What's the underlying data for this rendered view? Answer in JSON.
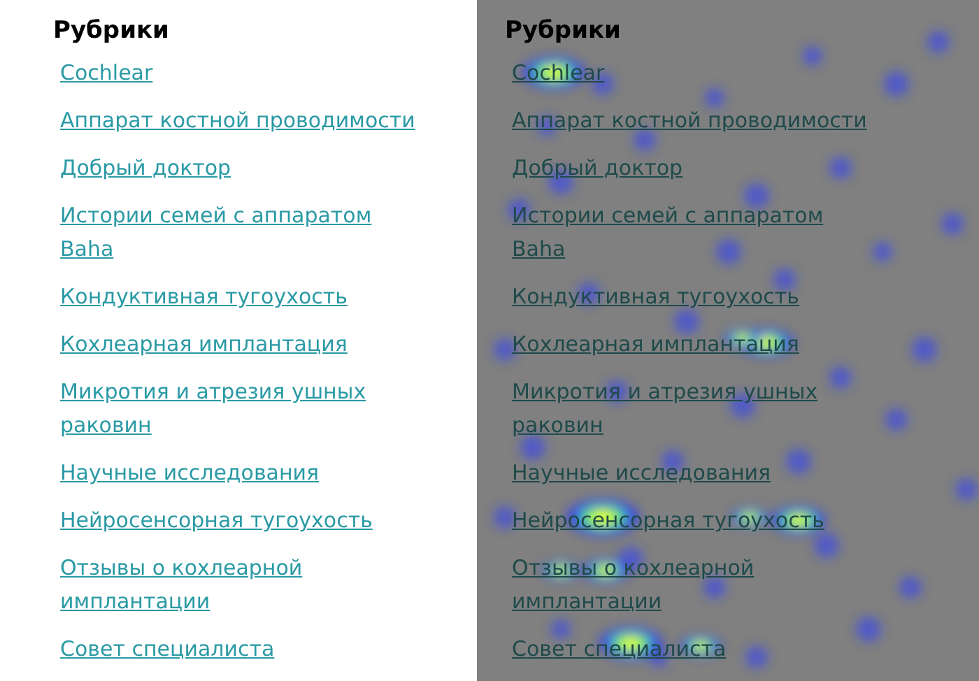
{
  "panels": [
    {
      "kind": "plain",
      "title": "Рубрики",
      "links": [
        "Cochlear",
        "Аппарат костной проводимости",
        "Добрый доктор",
        "Истории семей с аппаратом Baha",
        "Кондуктивная тугоухость",
        "Кохлеарная имплантация",
        "Микротия и атрезия ушных раковин",
        "Научные исследования",
        "Нейросенсорная тугоухость",
        "Отзывы о кохлеарной имплантации",
        "Совет специалиста"
      ]
    },
    {
      "kind": "heatmap",
      "title": "Рубрики",
      "links": [
        "Cochlear",
        "Аппарат костной проводимости",
        "Добрый доктор",
        "Истории семей с аппаратом Baha",
        "Кондуктивная тугоухость",
        "Кохлеарная имплантация",
        "Микротия и атрезия ушных раковин",
        "Научные исследования",
        "Нейросенсорная тугоухость",
        "Отзывы о кохлеарной имплантации",
        "Совет специалиста"
      ]
    }
  ]
}
